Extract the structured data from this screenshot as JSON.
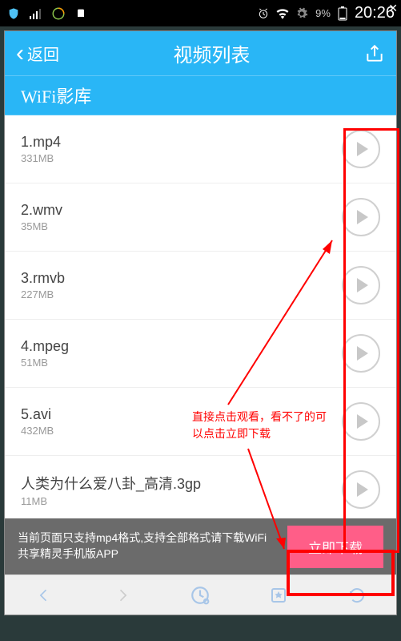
{
  "status": {
    "battery": "9%",
    "time": "20:26"
  },
  "header": {
    "back_label": "返回",
    "title": "视频列表"
  },
  "section": {
    "title": "WiFi影库"
  },
  "videos": [
    {
      "name": "1.mp4",
      "size": "331MB"
    },
    {
      "name": "2.wmv",
      "size": "35MB"
    },
    {
      "name": "3.rmvb",
      "size": "227MB"
    },
    {
      "name": "4.mpeg",
      "size": "51MB"
    },
    {
      "name": "5.avi",
      "size": "432MB"
    },
    {
      "name": "人类为什么爱八卦_高清.3gp",
      "size": "11MB"
    }
  ],
  "footer": {
    "text": "当前页面只支持mp4格式,支持全部格式请下载WiFi共享精灵手机版APP",
    "download_label": "立即下载"
  },
  "annotation": {
    "tip": "直接点击观看，看不了的可以点击立即下载"
  }
}
